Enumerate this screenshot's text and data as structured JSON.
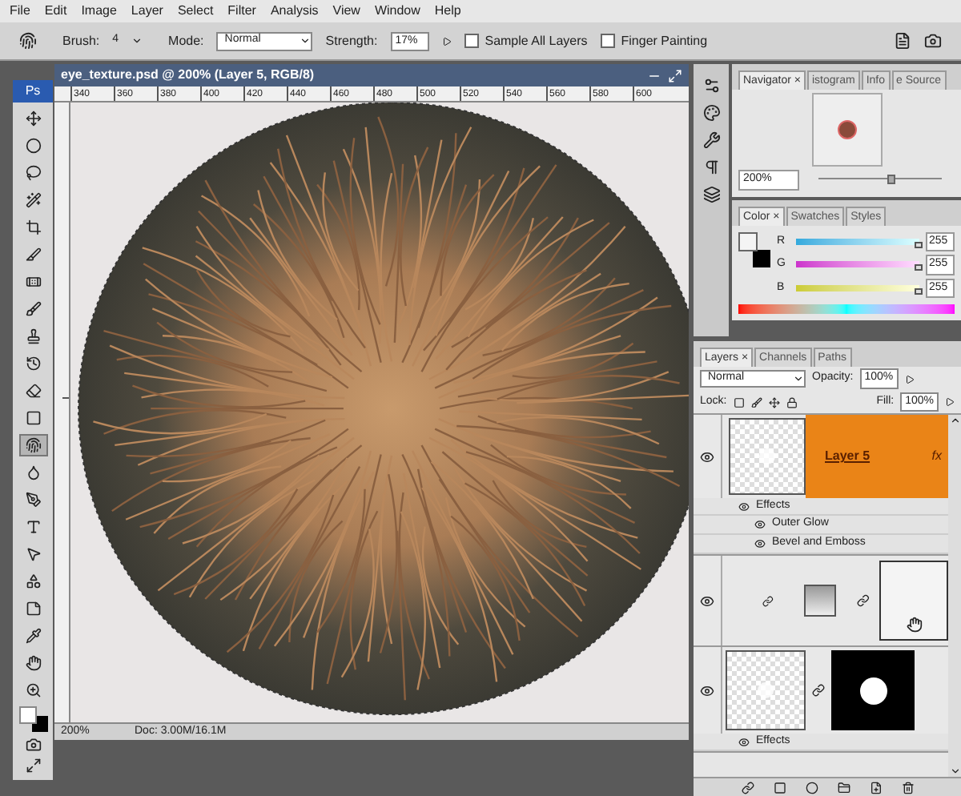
{
  "menu": [
    "File",
    "Edit",
    "Image",
    "Layer",
    "Select",
    "Filter",
    "Analysis",
    "View",
    "Window",
    "Help"
  ],
  "options": {
    "brush_label": "Brush:",
    "brush_size": "4",
    "mode_label": "Mode:",
    "mode": "Normal",
    "strength_label": "Strength:",
    "strength": "17%",
    "sample_all": {
      "label": "Sample All Layers",
      "checked": false
    },
    "finger_painting": {
      "label": "Finger Painting",
      "checked": false
    }
  },
  "toolbox": {
    "logo": "Ps"
  },
  "tools": [
    {
      "selected": false
    },
    {
      "selected": false
    },
    {
      "selected": false
    },
    {
      "selected": false
    },
    {
      "selected": false
    },
    {
      "selected": false
    },
    {
      "selected": false
    },
    {
      "selected": false
    },
    {
      "selected": false
    },
    {
      "selected": false
    },
    {
      "selected": false
    },
    {
      "selected": false
    },
    {
      "selected": true
    },
    {
      "selected": false
    },
    {
      "selected": false
    },
    {
      "selected": false
    },
    {
      "selected": false
    },
    {
      "selected": false
    },
    {
      "selected": false
    },
    {
      "selected": false
    },
    {
      "selected": false
    },
    {
      "selected": false
    }
  ],
  "document": {
    "title": "eye_texture.psd @ 200% (Layer 5, RGB/8)",
    "ruler_labels": [
      "340",
      "360",
      "380",
      "400",
      "420",
      "440",
      "460",
      "480",
      "500",
      "520",
      "540",
      "560",
      "580",
      "600"
    ],
    "zoom": "200%",
    "doc_info": "Doc: 3.00M/16.1M"
  },
  "navigator": {
    "tabs": [
      {
        "label": "Navigator",
        "selected": true,
        "close": "×"
      },
      {
        "label": "istogram",
        "selected": false
      },
      {
        "label": "Info",
        "selected": false
      },
      {
        "label": "e Source",
        "selected": false
      }
    ],
    "zoom": "200%",
    "level": 0.6
  },
  "color": {
    "tabs": [
      {
        "label": "Color",
        "selected": true,
        "close": "×"
      },
      {
        "label": "Swatches",
        "selected": false
      },
      {
        "label": "Styles",
        "selected": false
      }
    ],
    "channels": [
      {
        "name": "R",
        "value": "255",
        "level": 1
      },
      {
        "name": "G",
        "value": "255",
        "level": 1
      },
      {
        "name": "B",
        "value": "255",
        "level": 1
      }
    ]
  },
  "layers": {
    "tabs": [
      {
        "label": "Layers",
        "selected": true,
        "close": "×"
      },
      {
        "label": "Channels",
        "selected": false
      },
      {
        "label": "Paths",
        "selected": false
      }
    ],
    "blend_mode": "Normal",
    "opacity_label": "Opacity:",
    "opacity": "100%",
    "lock_label": "Lock:",
    "fill_label": "Fill:",
    "fill": "100%",
    "items": [
      {
        "kind": "layer",
        "name": "Layer 5",
        "fx": "fx",
        "selected": true,
        "visible": true,
        "effects": {
          "label": "Effects",
          "visible": true,
          "items": [
            {
              "name": "Outer Glow",
              "visible": true
            },
            {
              "name": "Bevel and Emboss",
              "visible": true
            }
          ]
        }
      },
      {
        "kind": "adjustment",
        "selected": false,
        "visible": true
      },
      {
        "kind": "masked",
        "selected": false,
        "visible": true,
        "effects": {
          "label": "Effects",
          "visible": true
        }
      }
    ]
  }
}
